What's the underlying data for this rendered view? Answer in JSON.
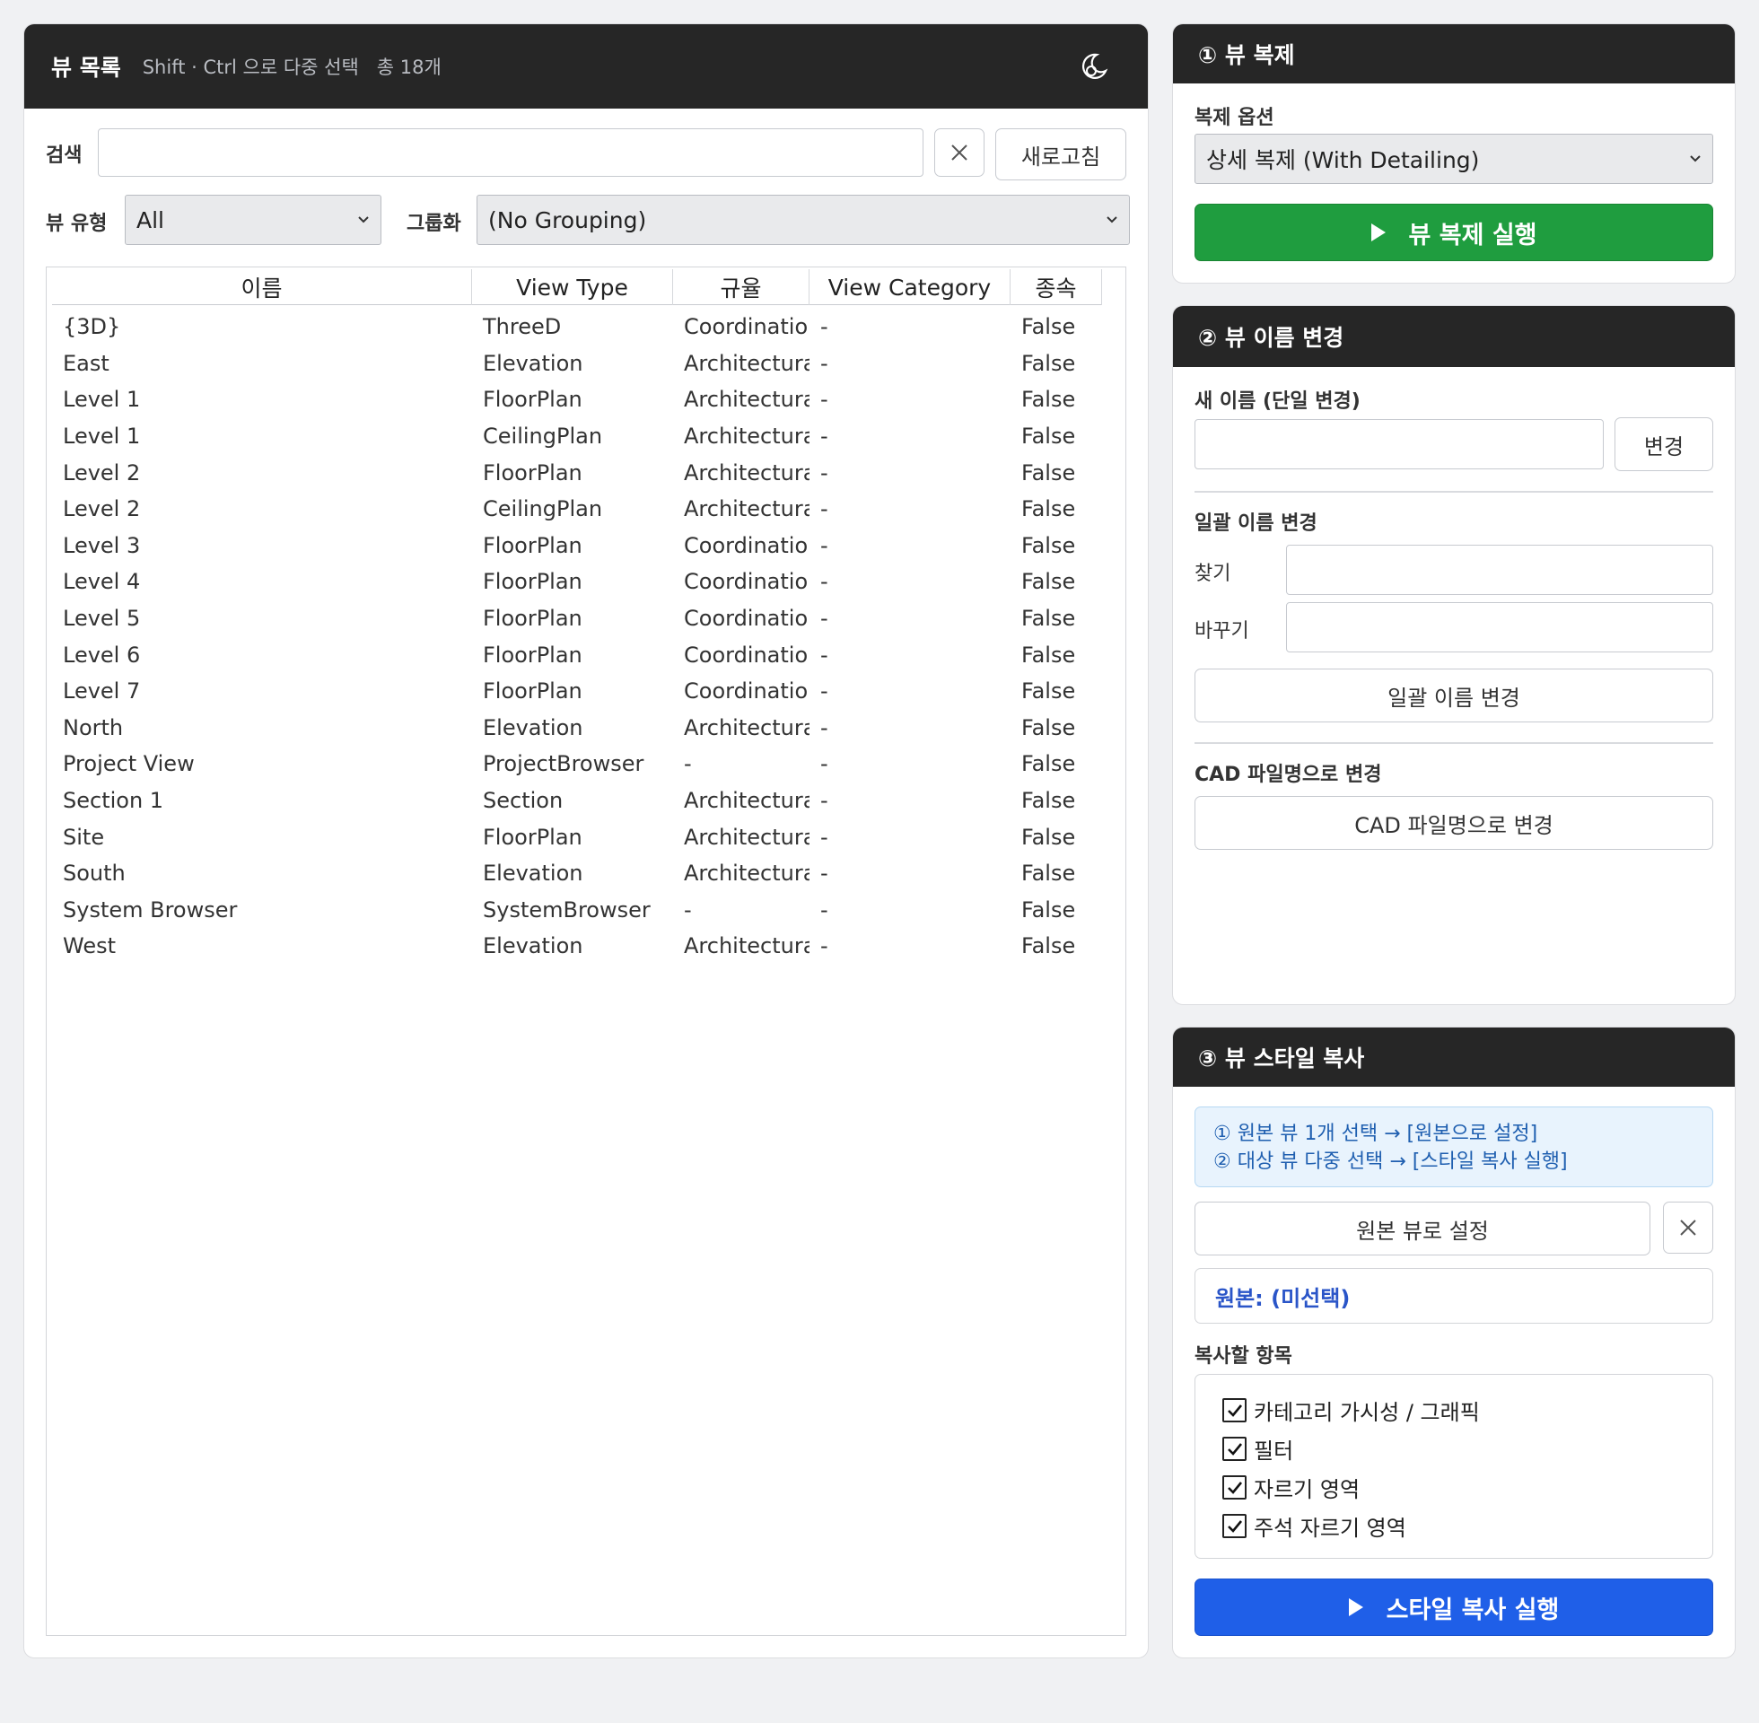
{
  "view_list": {
    "title": "뷰 목록",
    "hint": "Shift · Ctrl 으로 다중 선택",
    "count": "총 18개",
    "search_label": "검색",
    "search_value": "",
    "refresh_label": "새로고침",
    "view_type_label": "뷰 유형",
    "view_type_value": "All",
    "grouping_label": "그룹화",
    "grouping_value": "(No Grouping)",
    "columns": [
      "이름",
      "View Type",
      "규율",
      "View Category",
      "종속"
    ],
    "rows": [
      [
        "{3D}",
        "ThreeD",
        "Coordinatio",
        "-",
        "False"
      ],
      [
        "East",
        "Elevation",
        "Architectura",
        "-",
        "False"
      ],
      [
        "Level 1",
        "FloorPlan",
        "Architectura",
        "-",
        "False"
      ],
      [
        "Level 1",
        "CeilingPlan",
        "Architectura",
        "-",
        "False"
      ],
      [
        "Level 2",
        "FloorPlan",
        "Architectura",
        "-",
        "False"
      ],
      [
        "Level 2",
        "CeilingPlan",
        "Architectura",
        "-",
        "False"
      ],
      [
        "Level 3",
        "FloorPlan",
        "Coordinatio",
        "-",
        "False"
      ],
      [
        "Level 4",
        "FloorPlan",
        "Coordinatio",
        "-",
        "False"
      ],
      [
        "Level 5",
        "FloorPlan",
        "Coordinatio",
        "-",
        "False"
      ],
      [
        "Level 6",
        "FloorPlan",
        "Coordinatio",
        "-",
        "False"
      ],
      [
        "Level 7",
        "FloorPlan",
        "Coordinatio",
        "-",
        "False"
      ],
      [
        "North",
        "Elevation",
        "Architectura",
        "-",
        "False"
      ],
      [
        "Project View",
        "ProjectBrowser",
        "-",
        "-",
        "False"
      ],
      [
        "Section 1",
        "Section",
        "Architectura",
        "-",
        "False"
      ],
      [
        "Site",
        "FloorPlan",
        "Architectura",
        "-",
        "False"
      ],
      [
        "South",
        "Elevation",
        "Architectura",
        "-",
        "False"
      ],
      [
        "System Browser",
        "SystemBrowser",
        "-",
        "-",
        "False"
      ],
      [
        "West",
        "Elevation",
        "Architectura",
        "-",
        "False"
      ]
    ]
  },
  "duplicate": {
    "title": "① 뷰 복제",
    "option_label": "복제 옵션",
    "option_value": "상세 복제 (With Detailing)",
    "run_label": "뷰 복제 실행"
  },
  "rename": {
    "title": "② 뷰 이름 변경",
    "new_name_label": "새 이름 (단일 변경)",
    "new_name_value": "",
    "change_label": "변경",
    "batch_label": "일괄 이름 변경",
    "find_label": "찾기",
    "find_value": "",
    "replace_label": "바꾸기",
    "replace_value": "",
    "batch_button": "일괄 이름 변경",
    "cad_label": "CAD 파일명으로 변경",
    "cad_button": "CAD 파일명으로 변경"
  },
  "style_copy": {
    "title": "③ 뷰 스타일 복사",
    "info_line1": "① 원본 뷰 1개 선택 → [원본으로 설정]",
    "info_line2": "② 대상 뷰 다중 선택 → [스타일 복사 실행]",
    "set_source_label": "원본 뷰로 설정",
    "source_text": "원본: (미선택)",
    "items_label": "복사할 항목",
    "items": [
      "카테고리 가시성 / 그래픽",
      "필터",
      "자르기 영역",
      "주석 자르기 영역"
    ],
    "run_label": "스타일 복사 실행"
  },
  "colors": {
    "header_bg": "#262626",
    "green": "#1f9d3f",
    "blue": "#1f5fe8",
    "info_bg": "#e8f3fd"
  }
}
